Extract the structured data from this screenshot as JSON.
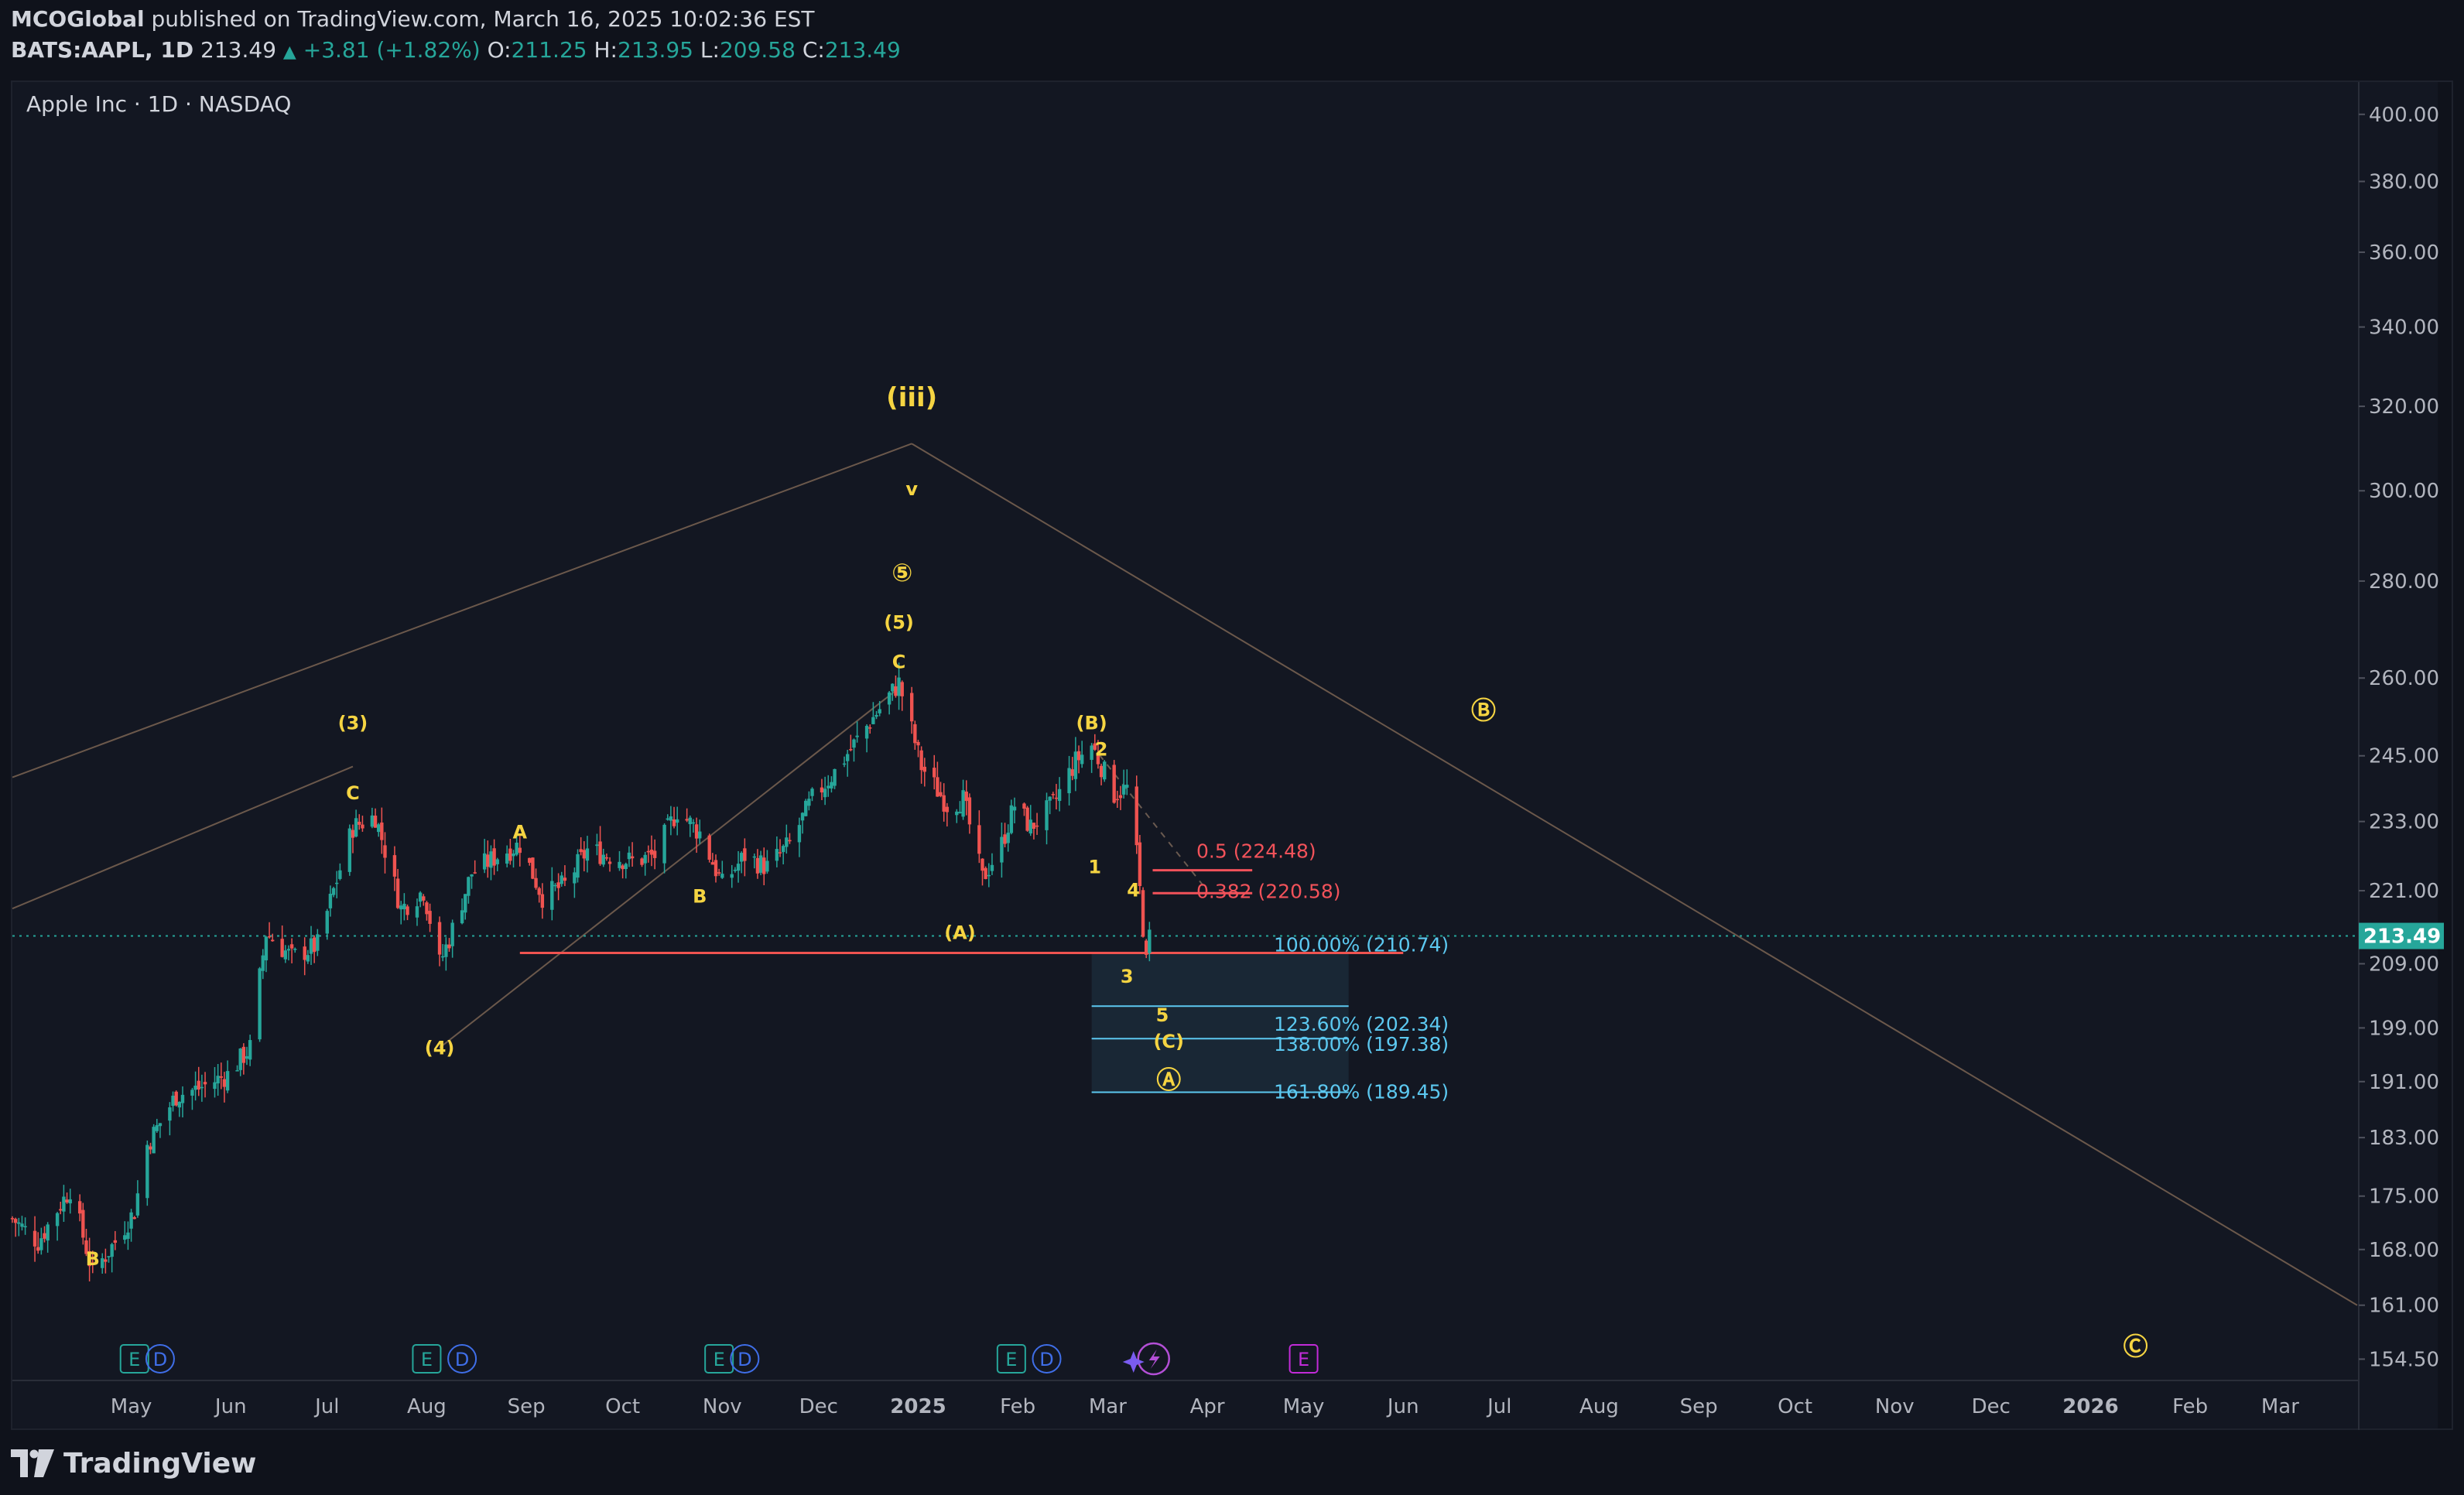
{
  "header": {
    "author": "MCOGlobal",
    "published": "published on TradingView.com, March 16, 2025 10:02:36 EST",
    "symbol": "BATS:AAPL, 1D",
    "last": "213.49",
    "change": "+3.81 (+1.82%)",
    "o_label": "O:",
    "o": "211.25",
    "h_label": "H:",
    "h": "213.95",
    "l_label": "L:",
    "l": "209.58",
    "c_label": "C:",
    "c": "213.49"
  },
  "legend_title": "Apple Inc · 1D · NASDAQ",
  "footer": {
    "brand": "TradingView"
  },
  "colors": {
    "bg": "#131722",
    "up": "#26a69a",
    "down": "#ef5350",
    "wave": "#f5d442",
    "fib": "#5cc8f0",
    "line": "#8a6f5a"
  },
  "chart_data": {
    "type": "candlestick",
    "y_axis_ticks": [
      "400.00",
      "380.00",
      "360.00",
      "340.00",
      "320.00",
      "300.00",
      "280.00",
      "260.00",
      "245.00",
      "233.00",
      "221.00",
      "209.00",
      "199.00",
      "191.00",
      "183.00",
      "175.00",
      "168.00",
      "161.00",
      "154.50"
    ],
    "y_scale": "log",
    "ylim": [
      152,
      410
    ],
    "x_axis_ticks": [
      "May",
      "Jun",
      "Jul",
      "Aug",
      "Sep",
      "Oct",
      "Nov",
      "Dec",
      "2025",
      "Feb",
      "Mar",
      "Apr",
      "May",
      "Jun",
      "Jul",
      "Aug",
      "Sep",
      "Oct",
      "Nov",
      "Dec",
      "2026",
      "Feb",
      "Mar"
    ],
    "last_price_label": "213.49",
    "wave_labels": [
      {
        "text": "B",
        "date": "2024-04-19",
        "price": 166
      },
      {
        "text": "(3)",
        "date": "2024-07-09",
        "price": 250
      },
      {
        "text": "C",
        "date": "2024-07-09",
        "price": 237
      },
      {
        "text": "(4)",
        "date": "2024-08-05",
        "price": 195
      },
      {
        "text": "A",
        "date": "2024-08-30",
        "price": 230
      },
      {
        "text": "B",
        "date": "2024-10-25",
        "price": 219
      },
      {
        "text": "(5)",
        "date": "2024-12-26",
        "price": 270
      },
      {
        "text": "C",
        "date": "2024-12-26",
        "price": 262
      },
      {
        "text": "(iii)",
        "date": "2024-12-30",
        "price": 320
      },
      {
        "text": "v",
        "date": "2024-12-30",
        "price": 299
      },
      {
        "text": "⑤",
        "date": "2024-12-27",
        "price": 280
      },
      {
        "text": "(A)",
        "date": "2025-01-14",
        "price": 213
      },
      {
        "text": "(B)",
        "date": "2025-02-24",
        "price": 250
      },
      {
        "text": "2",
        "date": "2025-02-27",
        "price": 245
      },
      {
        "text": "1",
        "date": "2025-02-25",
        "price": 224
      },
      {
        "text": "4",
        "date": "2025-03-09",
        "price": 220
      },
      {
        "text": "3",
        "date": "2025-03-07",
        "price": 206
      },
      {
        "text": "5",
        "date": "2025-03-18",
        "price": 200
      },
      {
        "text": "(C)",
        "date": "2025-03-20",
        "price": 196
      },
      {
        "text": "Ⓐ",
        "date": "2025-03-20",
        "price": 190
      },
      {
        "text": "Ⓑ",
        "date": "2025-06-26",
        "price": 252
      },
      {
        "text": "Ⓒ",
        "date": "2026-01-15",
        "price": 155
      }
    ],
    "fib_levels": [
      {
        "label": "0.5 (224.48)",
        "price": 224.48,
        "color": "#f2525a"
      },
      {
        "label": "0.382 (220.58)",
        "price": 220.58,
        "color": "#f2525a"
      },
      {
        "label": "100.00% (210.74)",
        "price": 210.74,
        "color": "#5cc8f0"
      },
      {
        "label": "123.60% (202.34)",
        "price": 202.34,
        "color": "#5cc8f0"
      },
      {
        "label": "138.00% (197.38)",
        "price": 197.38,
        "color": "#5cc8f0"
      },
      {
        "label": "161.80% (189.45)",
        "price": 189.45,
        "color": "#5cc8f0"
      }
    ],
    "events": [
      {
        "type": "E",
        "date": "2024-05-02"
      },
      {
        "type": "D",
        "date": "2024-05-10"
      },
      {
        "type": "E",
        "date": "2024-08-01"
      },
      {
        "type": "D",
        "date": "2024-08-12"
      },
      {
        "type": "E",
        "date": "2024-10-31"
      },
      {
        "type": "D",
        "date": "2024-11-08"
      },
      {
        "type": "E",
        "date": "2025-01-30"
      },
      {
        "type": "D",
        "date": "2025-02-10"
      },
      {
        "type": "split",
        "date": "2025-03-10"
      },
      {
        "type": "E",
        "date": "2025-05-01"
      }
    ],
    "trend_lines": [
      {
        "from": [
          "2024-03-25",
          241
        ],
        "to": [
          "2024-12-30",
          311
        ]
      },
      {
        "from": [
          "2024-12-30",
          311
        ],
        "to": [
          "2026-03-25",
          161
        ]
      },
      {
        "from": [
          "2024-03-25",
          218
        ],
        "to": [
          "2024-07-09",
          243
        ]
      },
      {
        "from": [
          "2024-08-05",
          196
        ],
        "to": [
          "2024-12-26",
          258
        ]
      }
    ],
    "close_path": [
      [
        "2024-03-25",
        172
      ],
      [
        "2024-04-02",
        169
      ],
      [
        "2024-04-12",
        176
      ],
      [
        "2024-04-19",
        165
      ],
      [
        "2024-04-26",
        169
      ],
      [
        "2024-05-02",
        173
      ],
      [
        "2024-05-06",
        182
      ],
      [
        "2024-05-15",
        189
      ],
      [
        "2024-05-22",
        190
      ],
      [
        "2024-05-31",
        192
      ],
      [
        "2024-06-07",
        196
      ],
      [
        "2024-06-12",
        214
      ],
      [
        "2024-06-20",
        210
      ],
      [
        "2024-06-28",
        212
      ],
      [
        "2024-07-03",
        221
      ],
      [
        "2024-07-09",
        232
      ],
      [
        "2024-07-16",
        234
      ],
      [
        "2024-07-24",
        218
      ],
      [
        "2024-07-31",
        221
      ],
      [
        "2024-08-05",
        209
      ],
      [
        "2024-08-08",
        213
      ],
      [
        "2024-08-15",
        224
      ],
      [
        "2024-08-23",
        227
      ],
      [
        "2024-08-30",
        229
      ],
      [
        "2024-09-06",
        220
      ],
      [
        "2024-09-13",
        222
      ],
      [
        "2024-09-20",
        228
      ],
      [
        "2024-09-27",
        227
      ],
      [
        "2024-10-04",
        226
      ],
      [
        "2024-10-11",
        227
      ],
      [
        "2024-10-18",
        235
      ],
      [
        "2024-10-25",
        231
      ],
      [
        "2024-11-01",
        222
      ],
      [
        "2024-11-08",
        227
      ],
      [
        "2024-11-15",
        225
      ],
      [
        "2024-11-22",
        229
      ],
      [
        "2024-11-29",
        237
      ],
      [
        "2024-12-06",
        242
      ],
      [
        "2024-12-13",
        248
      ],
      [
        "2024-12-20",
        254
      ],
      [
        "2024-12-26",
        259
      ],
      [
        "2025-01-02",
        243
      ],
      [
        "2025-01-10",
        236
      ],
      [
        "2025-01-15",
        237
      ],
      [
        "2025-01-21",
        223
      ],
      [
        "2025-01-27",
        229
      ],
      [
        "2025-01-31",
        236
      ],
      [
        "2025-02-05",
        232
      ],
      [
        "2025-02-12",
        236
      ],
      [
        "2025-02-19",
        244
      ],
      [
        "2025-02-24",
        247
      ],
      [
        "2025-03-03",
        238
      ],
      [
        "2025-03-07",
        239
      ],
      [
        "2025-03-10",
        227
      ],
      [
        "2025-03-13",
        209
      ],
      [
        "2025-03-14",
        213.49
      ]
    ]
  }
}
